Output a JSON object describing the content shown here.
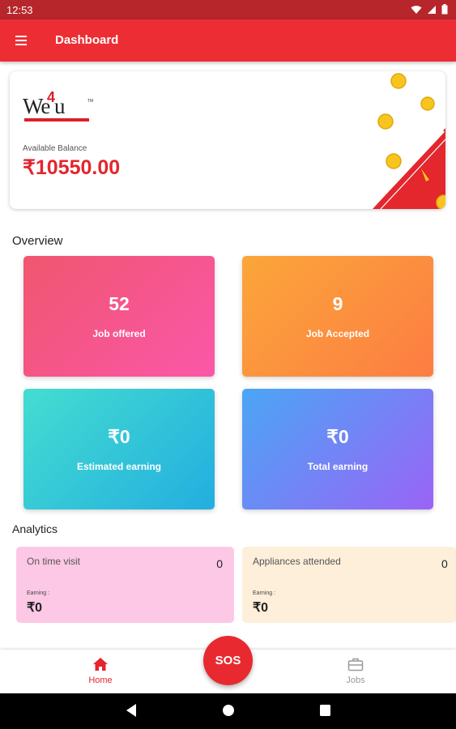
{
  "status_bar": {
    "time": "12:53"
  },
  "app_bar": {
    "title": "Dashboard"
  },
  "balance": {
    "logo_text": "We u",
    "logo_four": "4",
    "label": "Available Balance",
    "amount": "₹10550.00"
  },
  "overview": {
    "title": "Overview",
    "cards": [
      {
        "value": "52",
        "label": "Job offered"
      },
      {
        "value": "9",
        "label": "Job Accepted"
      },
      {
        "value": "₹0",
        "label": "Estimated earning"
      },
      {
        "value": "₹0",
        "label": "Total earning"
      }
    ]
  },
  "analytics": {
    "title": "Analytics",
    "cards": [
      {
        "title": "On time visit",
        "count": "0",
        "earning_label": "Earning :",
        "earning_value": "₹0"
      },
      {
        "title": "Appliances attended",
        "count": "0",
        "earning_label": "Earning :",
        "earning_value": "₹0"
      }
    ]
  },
  "sos": {
    "label": "SOS"
  },
  "bottom_nav": {
    "home": "Home",
    "jobs": "Jobs"
  },
  "colors": {
    "primary": "#ec2d34",
    "status_bar": "#b7262b",
    "active_nav": "#e3262e"
  }
}
